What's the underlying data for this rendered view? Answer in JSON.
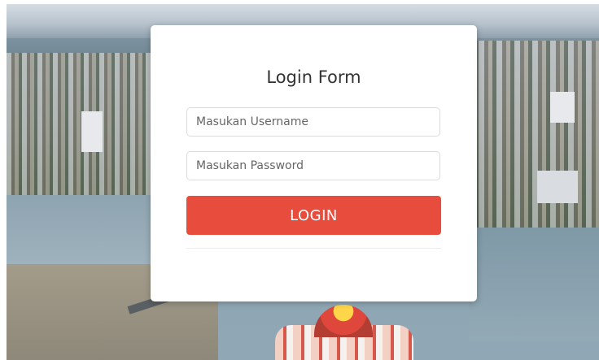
{
  "login": {
    "title": "Login Form",
    "username_placeholder": "Masukan Username",
    "password_placeholder": "Masukan Password",
    "button_label": "LOGIN"
  },
  "colors": {
    "button": "#e84c3d",
    "card_background": "#ffffff"
  }
}
